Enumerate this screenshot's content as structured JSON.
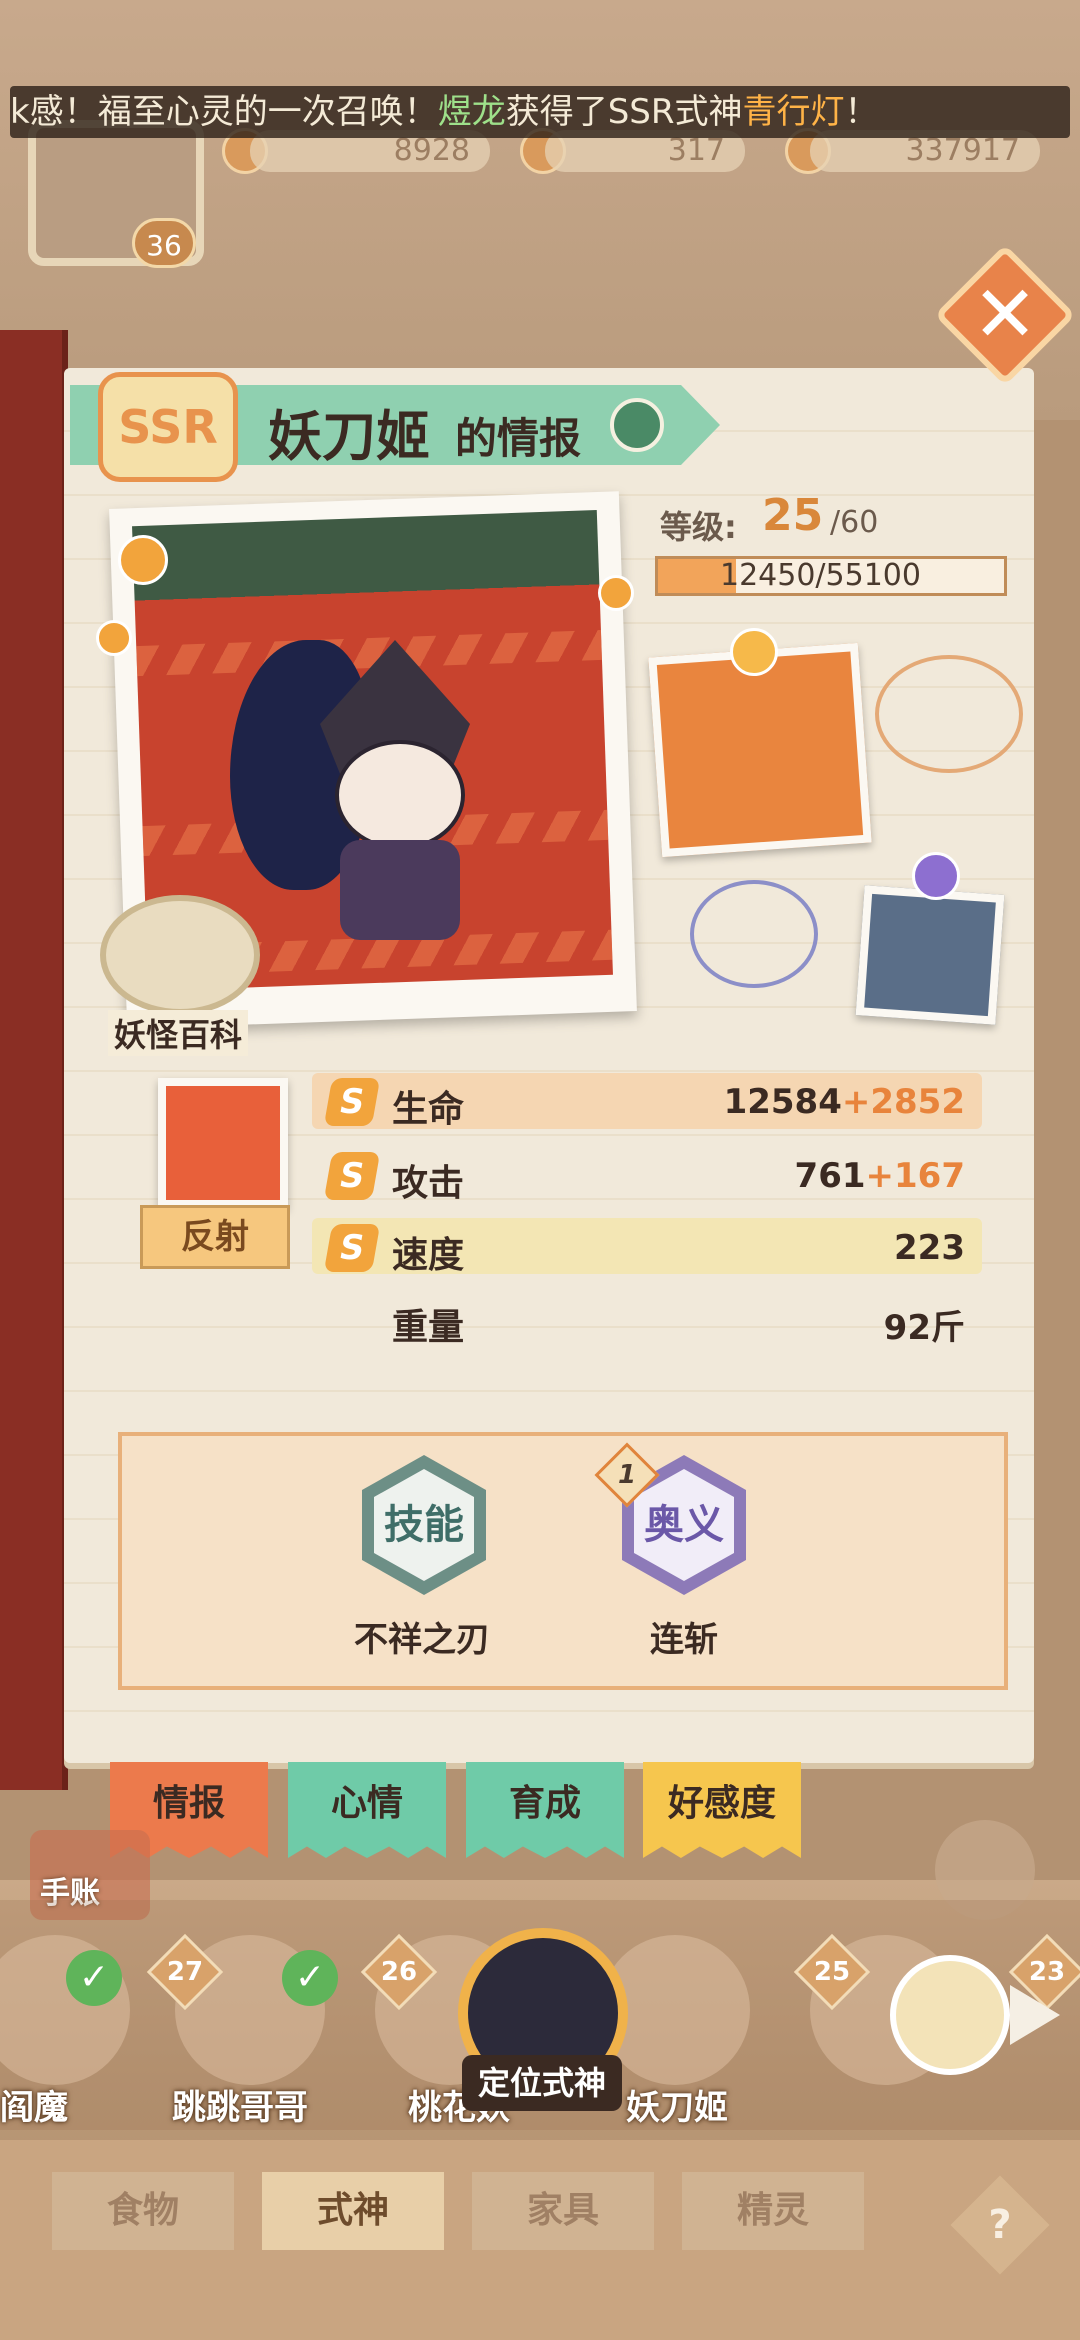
{
  "announcement": {
    "prefix": "k感！福至心灵的一次召唤！",
    "player": "煜龙",
    "middle": "获得了SSR式神",
    "shikigami": "青行灯",
    "suffix": "！"
  },
  "resources": {
    "res1": "8928",
    "res2": "317",
    "res3": "337917",
    "player_level": "36"
  },
  "card": {
    "rarity": "SSR",
    "name": "妖刀姬",
    "title_suffix": "的情报",
    "encyclopedia_label": "妖怪百科",
    "level_label": "等级:",
    "level": "25",
    "level_max": "/60",
    "exp_text": "12450/55100",
    "exp_fraction": 0.226
  },
  "skill_type": {
    "label": "反射"
  },
  "stats": [
    {
      "name": "生命",
      "base": "12584",
      "bonus": "+2852"
    },
    {
      "name": "攻击",
      "base": "761",
      "bonus": "+167"
    },
    {
      "name": "速度",
      "base": "223",
      "bonus": ""
    },
    {
      "name": "重量",
      "base": "92斤",
      "bonus": ""
    }
  ],
  "skills": {
    "skill_icon_label": "技能",
    "skill_name": "不祥之刃",
    "ougi_icon_label": "奥义",
    "ougi_level": "1",
    "ougi_name": "连斩"
  },
  "tabs": [
    "情报",
    "心情",
    "育成",
    "好感度"
  ],
  "carousel": {
    "slots": [
      {
        "name": "阎魔",
        "level": ""
      },
      {
        "name": "跳跳哥哥",
        "level": "27"
      },
      {
        "name": "桃花妖",
        "level": "26"
      },
      {
        "name": "妖刀姬",
        "level": "25"
      },
      {
        "name": "",
        "level": "25"
      },
      {
        "name": "",
        "level": "23"
      }
    ],
    "locate_label": "定位式神",
    "handbook_label": "手账"
  },
  "bottom_tabs": [
    "食物",
    "式神",
    "家具",
    "精灵"
  ],
  "help": "?",
  "s_mark": "S",
  "close_mark": "✕"
}
